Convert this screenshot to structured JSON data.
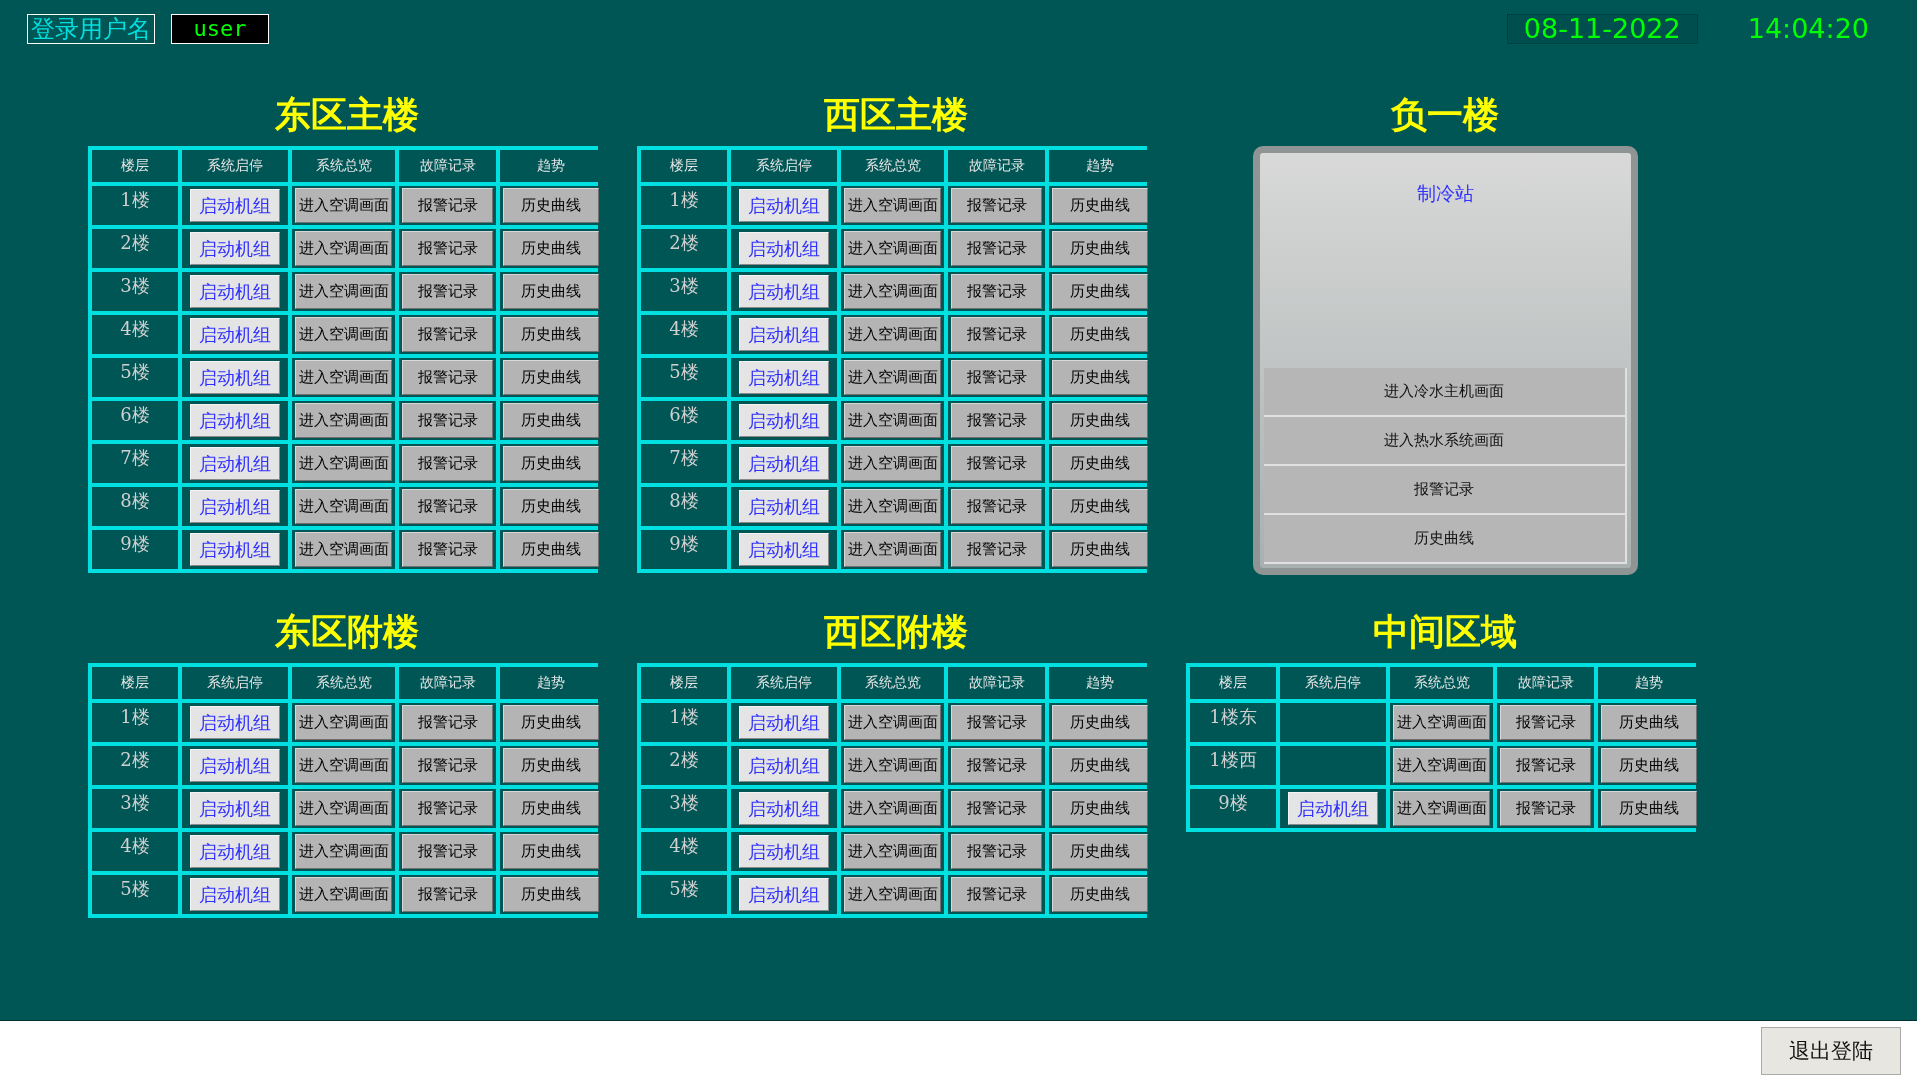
{
  "header": {
    "user_label": "登录用户名",
    "user_value": "user",
    "date": "08-11-2022",
    "time": "14:04:20"
  },
  "sections": [
    {
      "kind": "table",
      "title": "东区主楼",
      "columns": [
        "楼层",
        "系统启停",
        "系统总览",
        "故障记录",
        "趋势"
      ],
      "rows": [
        {
          "floor": "1楼",
          "start": "启动机组",
          "overview": "进入空调画面",
          "alarm": "报警记录",
          "trend": "历史曲线"
        },
        {
          "floor": "2楼",
          "start": "启动机组",
          "overview": "进入空调画面",
          "alarm": "报警记录",
          "trend": "历史曲线"
        },
        {
          "floor": "3楼",
          "start": "启动机组",
          "overview": "进入空调画面",
          "alarm": "报警记录",
          "trend": "历史曲线"
        },
        {
          "floor": "4楼",
          "start": "启动机组",
          "overview": "进入空调画面",
          "alarm": "报警记录",
          "trend": "历史曲线"
        },
        {
          "floor": "5楼",
          "start": "启动机组",
          "overview": "进入空调画面",
          "alarm": "报警记录",
          "trend": "历史曲线"
        },
        {
          "floor": "6楼",
          "start": "启动机组",
          "overview": "进入空调画面",
          "alarm": "报警记录",
          "trend": "历史曲线"
        },
        {
          "floor": "7楼",
          "start": "启动机组",
          "overview": "进入空调画面",
          "alarm": "报警记录",
          "trend": "历史曲线"
        },
        {
          "floor": "8楼",
          "start": "启动机组",
          "overview": "进入空调画面",
          "alarm": "报警记录",
          "trend": "历史曲线"
        },
        {
          "floor": "9楼",
          "start": "启动机组",
          "overview": "进入空调画面",
          "alarm": "报警记录",
          "trend": "历史曲线"
        }
      ]
    },
    {
      "kind": "table",
      "title": "西区主楼",
      "columns": [
        "楼层",
        "系统启停",
        "系统总览",
        "故障记录",
        "趋势"
      ],
      "rows": [
        {
          "floor": "1楼",
          "start": "启动机组",
          "overview": "进入空调画面",
          "alarm": "报警记录",
          "trend": "历史曲线"
        },
        {
          "floor": "2楼",
          "start": "启动机组",
          "overview": "进入空调画面",
          "alarm": "报警记录",
          "trend": "历史曲线"
        },
        {
          "floor": "3楼",
          "start": "启动机组",
          "overview": "进入空调画面",
          "alarm": "报警记录",
          "trend": "历史曲线"
        },
        {
          "floor": "4楼",
          "start": "启动机组",
          "overview": "进入空调画面",
          "alarm": "报警记录",
          "trend": "历史曲线"
        },
        {
          "floor": "5楼",
          "start": "启动机组",
          "overview": "进入空调画面",
          "alarm": "报警记录",
          "trend": "历史曲线"
        },
        {
          "floor": "6楼",
          "start": "启动机组",
          "overview": "进入空调画面",
          "alarm": "报警记录",
          "trend": "历史曲线"
        },
        {
          "floor": "7楼",
          "start": "启动机组",
          "overview": "进入空调画面",
          "alarm": "报警记录",
          "trend": "历史曲线"
        },
        {
          "floor": "8楼",
          "start": "启动机组",
          "overview": "进入空调画面",
          "alarm": "报警记录",
          "trend": "历史曲线"
        },
        {
          "floor": "9楼",
          "start": "启动机组",
          "overview": "进入空调画面",
          "alarm": "报警记录",
          "trend": "历史曲线"
        }
      ]
    },
    {
      "kind": "panel",
      "title": "负一楼",
      "panel_title": "制冷站",
      "items": [
        "进入冷水主机画面",
        "进入热水系统画面",
        "报警记录",
        "历史曲线"
      ]
    },
    {
      "kind": "table",
      "title": "东区附楼",
      "columns": [
        "楼层",
        "系统启停",
        "系统总览",
        "故障记录",
        "趋势"
      ],
      "rows": [
        {
          "floor": "1楼",
          "start": "启动机组",
          "overview": "进入空调画面",
          "alarm": "报警记录",
          "trend": "历史曲线"
        },
        {
          "floor": "2楼",
          "start": "启动机组",
          "overview": "进入空调画面",
          "alarm": "报警记录",
          "trend": "历史曲线"
        },
        {
          "floor": "3楼",
          "start": "启动机组",
          "overview": "进入空调画面",
          "alarm": "报警记录",
          "trend": "历史曲线"
        },
        {
          "floor": "4楼",
          "start": "启动机组",
          "overview": "进入空调画面",
          "alarm": "报警记录",
          "trend": "历史曲线"
        },
        {
          "floor": "5楼",
          "start": "启动机组",
          "overview": "进入空调画面",
          "alarm": "报警记录",
          "trend": "历史曲线"
        }
      ]
    },
    {
      "kind": "table",
      "title": "西区附楼",
      "columns": [
        "楼层",
        "系统启停",
        "系统总览",
        "故障记录",
        "趋势"
      ],
      "rows": [
        {
          "floor": "1楼",
          "start": "启动机组",
          "overview": "进入空调画面",
          "alarm": "报警记录",
          "trend": "历史曲线"
        },
        {
          "floor": "2楼",
          "start": "启动机组",
          "overview": "进入空调画面",
          "alarm": "报警记录",
          "trend": "历史曲线"
        },
        {
          "floor": "3楼",
          "start": "启动机组",
          "overview": "进入空调画面",
          "alarm": "报警记录",
          "trend": "历史曲线"
        },
        {
          "floor": "4楼",
          "start": "启动机组",
          "overview": "进入空调画面",
          "alarm": "报警记录",
          "trend": "历史曲线"
        },
        {
          "floor": "5楼",
          "start": "启动机组",
          "overview": "进入空调画面",
          "alarm": "报警记录",
          "trend": "历史曲线"
        }
      ]
    },
    {
      "kind": "table",
      "title": "中间区域",
      "columns": [
        "楼层",
        "系统启停",
        "系统总览",
        "故障记录",
        "趋势"
      ],
      "rows": [
        {
          "floor": "1楼东",
          "overview": "进入空调画面",
          "alarm": "报警记录",
          "trend": "历史曲线"
        },
        {
          "floor": "1楼西",
          "overview": "进入空调画面",
          "alarm": "报警记录",
          "trend": "历史曲线"
        },
        {
          "floor": "9楼",
          "start": "启动机组",
          "overview": "进入空调画面",
          "alarm": "报警记录",
          "trend": "历史曲线"
        }
      ]
    }
  ],
  "footer": {
    "logout_button": "退出登陆"
  }
}
